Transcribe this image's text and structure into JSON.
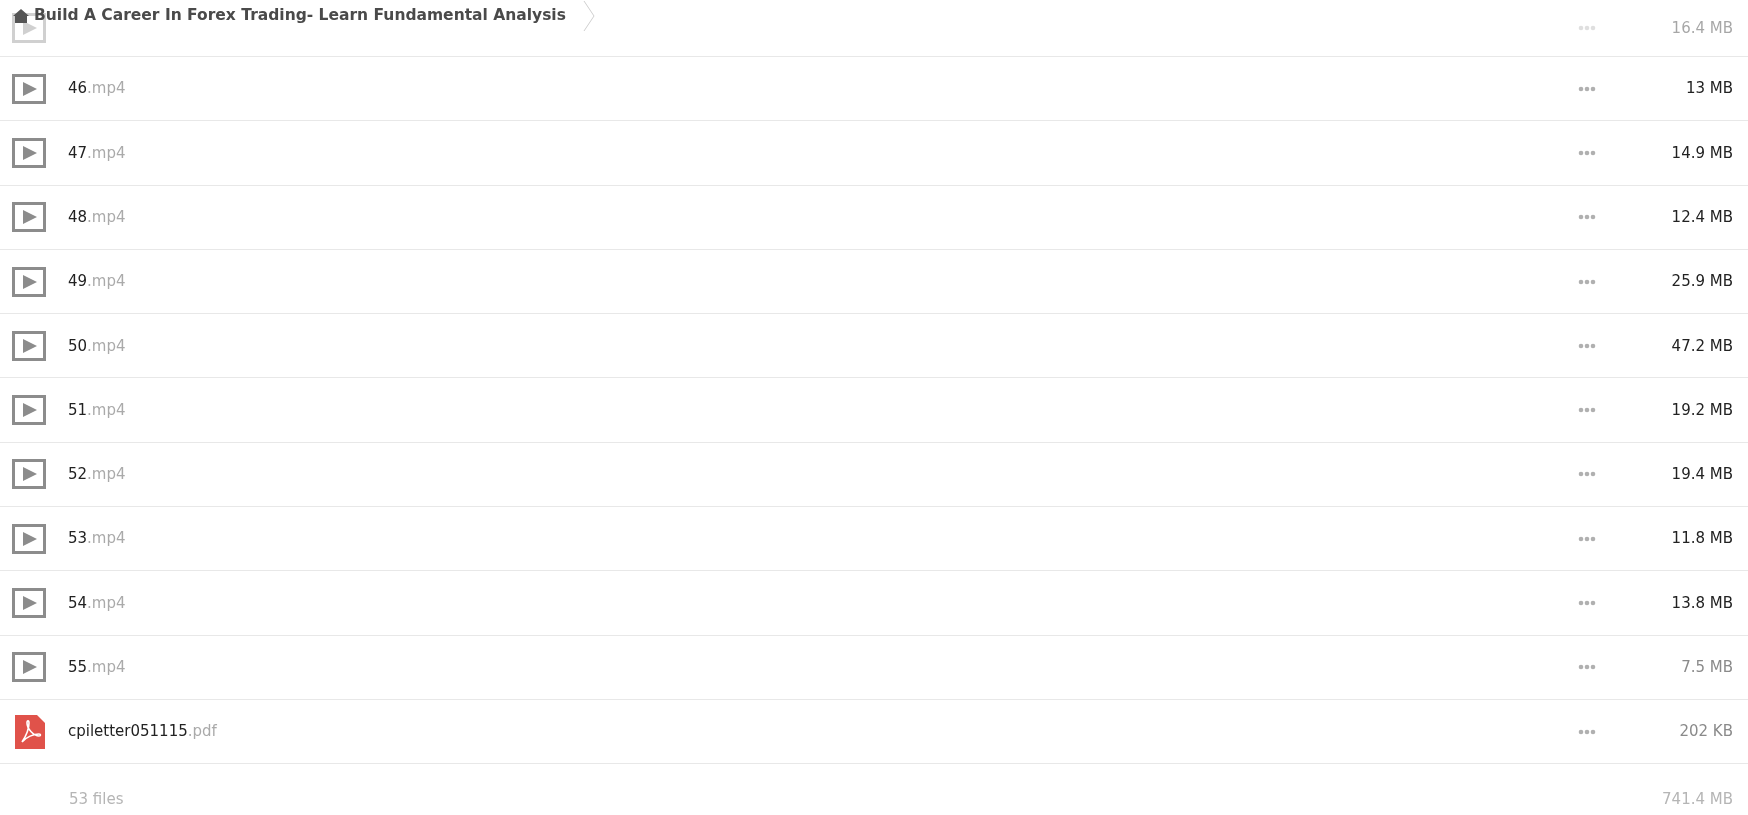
{
  "breadcrumb": {
    "title": "Build A Career In Forex Trading- Learn Fundamental Analysis"
  },
  "files": [
    {
      "kind": "video",
      "size": "16.4 MB",
      "faded": true,
      "muted_size": false
    },
    {
      "kind": "video",
      "name": "46",
      "ext": ".mp4",
      "size": "13 MB",
      "faded": false,
      "muted_size": false
    },
    {
      "kind": "video",
      "name": "47",
      "ext": ".mp4",
      "size": "14.9 MB",
      "faded": false,
      "muted_size": false
    },
    {
      "kind": "video",
      "name": "48",
      "ext": ".mp4",
      "size": "12.4 MB",
      "faded": false,
      "muted_size": false
    },
    {
      "kind": "video",
      "name": "49",
      "ext": ".mp4",
      "size": "25.9 MB",
      "faded": false,
      "muted_size": false
    },
    {
      "kind": "video",
      "name": "50",
      "ext": ".mp4",
      "size": "47.2 MB",
      "faded": false,
      "muted_size": false
    },
    {
      "kind": "video",
      "name": "51",
      "ext": ".mp4",
      "size": "19.2 MB",
      "faded": false,
      "muted_size": false
    },
    {
      "kind": "video",
      "name": "52",
      "ext": ".mp4",
      "size": "19.4 MB",
      "faded": false,
      "muted_size": false
    },
    {
      "kind": "video",
      "name": "53",
      "ext": ".mp4",
      "size": "11.8 MB",
      "faded": false,
      "muted_size": false
    },
    {
      "kind": "video",
      "name": "54",
      "ext": ".mp4",
      "size": "13.8 MB",
      "faded": false,
      "muted_size": false
    },
    {
      "kind": "video",
      "name": "55",
      "ext": ".mp4",
      "size": "7.5 MB",
      "faded": false,
      "muted_size": true
    },
    {
      "kind": "pdf",
      "name": "cpiletter051115",
      "ext": ".pdf",
      "size": "202 KB",
      "faded": false,
      "muted_size": true
    }
  ],
  "footer": {
    "count": "53 files",
    "total": "741.4 MB"
  }
}
